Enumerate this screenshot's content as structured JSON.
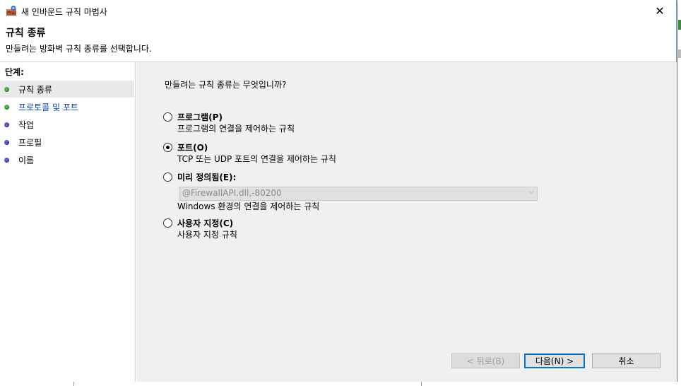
{
  "window": {
    "title": "새 인바운드 규칙 마법사",
    "close_glyph": "✕"
  },
  "header": {
    "title": "규칙 종류",
    "subtitle": "만들려는 방화벽 규칙 종류를 선택합니다."
  },
  "steps": {
    "title": "단계:",
    "items": [
      {
        "label": "규칙 종류",
        "status": "done",
        "color": "#4fae4f"
      },
      {
        "label": "프로토콜 및 포트",
        "status": "current",
        "color": "#4fae4f"
      },
      {
        "label": "작업",
        "status": "pending",
        "color": "#5b5bc9"
      },
      {
        "label": "프로필",
        "status": "pending",
        "color": "#5b5bc9"
      },
      {
        "label": "이름",
        "status": "pending",
        "color": "#5b5bc9"
      }
    ]
  },
  "main": {
    "question": "만들려는 규칙 종류는 무엇입니까?",
    "options": [
      {
        "label": "프로그램(P)",
        "desc": "프로그램의 연결을 제어하는 규칙",
        "checked": false
      },
      {
        "label": "포트(O)",
        "desc": "TCP 또는 UDP 포트의 연결을 제어하는 규칙",
        "checked": true
      },
      {
        "label": "미리 정의됨(E):",
        "desc": "Windows 환경의 연결을 제어하는 규칙",
        "checked": false
      },
      {
        "label": "사용자 지정(C)",
        "desc": "사용자 지정 규칙",
        "checked": false
      }
    ],
    "predefined_select": {
      "value": "@FirewallAPI.dll,-80200",
      "arrow": "⌵"
    }
  },
  "buttons": {
    "back": "< 뒤로(B)",
    "next": "다음(N) >",
    "cancel": "취소"
  },
  "colors": {
    "accent": "#0078d7",
    "link": "#0645ad"
  }
}
